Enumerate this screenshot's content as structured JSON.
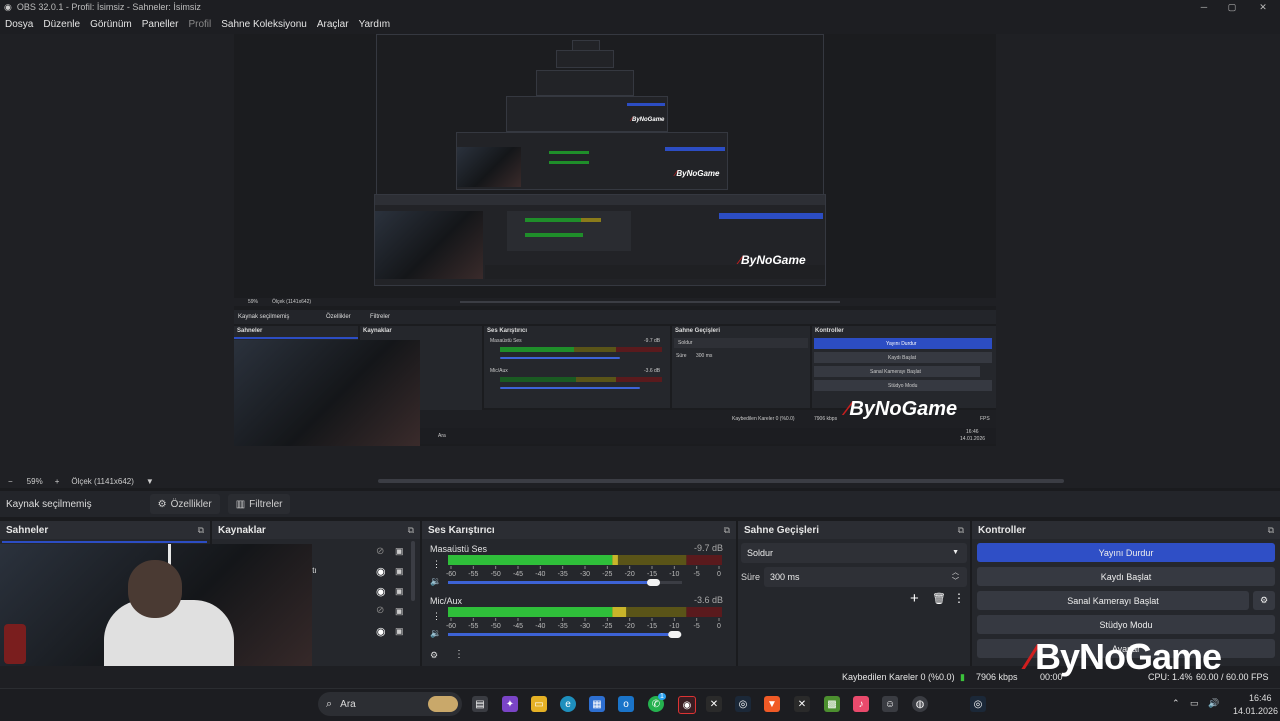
{
  "window": {
    "title": "OBS 32.0.1 - Profil: İsimsiz - Sahneler: İsimsiz"
  },
  "menu": [
    "Dosya",
    "Düzenle",
    "Görünüm",
    "Paneller",
    "Profil",
    "Sahne Koleksiyonu",
    "Araçlar",
    "Yardım"
  ],
  "preview": {
    "zoom": "59%",
    "scale": "Ölçek (1141x642)",
    "overlay_logo": "ByNoGame",
    "nested": {
      "source_status": "Kaynak seçilmemiş",
      "properties": "Özellikler",
      "filters": "Filtreler",
      "zoom": "59%",
      "scale": "Ölçek (1141x642)",
      "scenes": "Sahneler",
      "sources": "Kaynaklar",
      "mixer": "Ses Karıştırıcı",
      "transitions": "Sahne Geçişleri",
      "controls": "Kontroller",
      "desktop_audio": "Masaüstü Ses",
      "desktop_db": "-9.7 dB",
      "mic": "Mic/Aux",
      "mic_db": "-3.6 dB",
      "transition": "Soldur",
      "duration_label": "Süre",
      "duration": "300 ms",
      "stop_stream": "Yayını Durdur",
      "start_record": "Kaydı Başlat",
      "virtual_cam": "Sanal Kamerayı Başlat",
      "studio_mode": "Stüdyo Modu",
      "dropped": "Kaybedilen Kareler 0 (%0.0)",
      "kbps": "7906 kbps",
      "fps": "FPS",
      "search": "Ara",
      "time": "16:46",
      "date": "14.01.2026"
    }
  },
  "source_toolbar": {
    "status": "Kaynak seçilmemiş",
    "properties": "Özellikler",
    "filters": "Filtreler"
  },
  "docks": {
    "scenes": {
      "title": "Sahneler"
    },
    "sources": {
      "title": "Kaynaklar",
      "partial_text": "ıtı"
    },
    "mixer": {
      "title": "Ses Karıştırıcı",
      "channels": [
        {
          "name": "Masaüstü Ses",
          "db": "-9.7 dB",
          "level": 0.62,
          "volume": 0.87
        },
        {
          "name": "Mic/Aux",
          "db": "-3.6 dB",
          "level": 0.65,
          "volume": 0.96
        }
      ],
      "ticks": [
        "-60",
        "-55",
        "-50",
        "-45",
        "-40",
        "-35",
        "-30",
        "-25",
        "-20",
        "-15",
        "-10",
        "-5",
        "0"
      ]
    },
    "transitions": {
      "title": "Sahne Geçişleri",
      "selected": "Soldur",
      "duration_label": "Süre",
      "duration": "300 ms"
    },
    "controls": {
      "title": "Kontroller",
      "stop_stream": "Yayını Durdur",
      "start_record": "Kaydı Başlat",
      "virtual_cam": "Sanal Kamerayı Başlat",
      "studio_mode": "Stüdyo Modu",
      "settings": "Ayarlar"
    }
  },
  "status": {
    "dropped": "Kaybedilen Kareler 0 (%0.0)",
    "kbps": "7906 kbps",
    "rec": "00:00",
    "cpu": "CPU: 1.4%",
    "fps": "60.00 / 60.00 FPS"
  },
  "overlay_logo": "ByNoGame",
  "taskbar": {
    "search": "Ara",
    "time": "16:46",
    "date": "14.01.2026",
    "badge": "1"
  },
  "colors": {
    "accent": "#2f4fc6",
    "meter_green": "#1f8e2a",
    "meter_yellow": "#8a7b1a",
    "meter_red": "#7d1d22",
    "logo_red": "#d11e1e"
  }
}
